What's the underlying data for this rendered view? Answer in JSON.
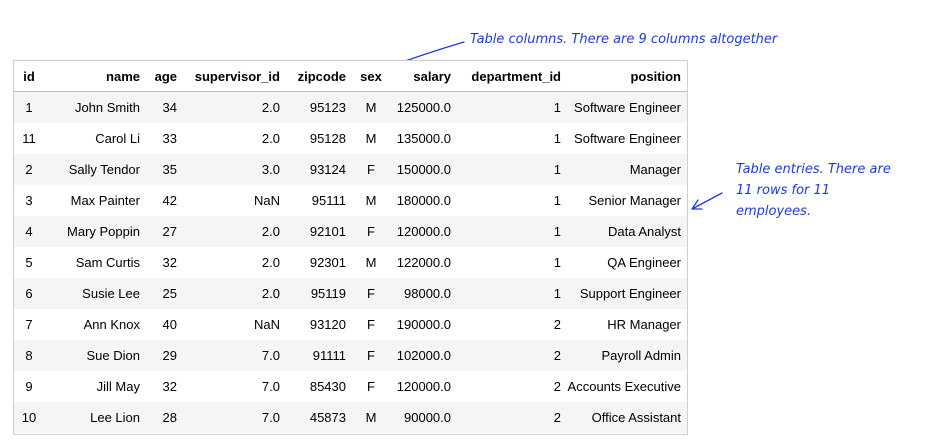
{
  "annotations": {
    "columns_note": "Table columns. There are 9 columns altogether",
    "rows_note": "Table entries. There are 11 rows for 11 employees.",
    "rows_note_lines": [
      "Table entries. There are",
      "11 rows for 11",
      "employees."
    ],
    "color": "#1f3bd6"
  },
  "table": {
    "columns": [
      "id",
      "name",
      "age",
      "supervisor_id",
      "zipcode",
      "sex",
      "salary",
      "department_id",
      "position"
    ],
    "rows": [
      [
        "1",
        "John Smith",
        "34",
        "2.0",
        "95123",
        "M",
        "125000.0",
        "1",
        "Software Engineer"
      ],
      [
        "11",
        "Carol Li",
        "33",
        "2.0",
        "95128",
        "M",
        "135000.0",
        "1",
        "Software Engineer"
      ],
      [
        "2",
        "Sally Tendor",
        "35",
        "3.0",
        "93124",
        "F",
        "150000.0",
        "1",
        "Manager"
      ],
      [
        "3",
        "Max Painter",
        "42",
        "NaN",
        "95111",
        "M",
        "180000.0",
        "1",
        "Senior Manager"
      ],
      [
        "4",
        "Mary Poppin",
        "27",
        "2.0",
        "92101",
        "F",
        "120000.0",
        "1",
        "Data Analyst"
      ],
      [
        "5",
        "Sam Curtis",
        "32",
        "2.0",
        "92301",
        "M",
        "122000.0",
        "1",
        "QA Engineer"
      ],
      [
        "6",
        "Susie Lee",
        "25",
        "2.0",
        "95119",
        "F",
        "98000.0",
        "1",
        "Support Engineer"
      ],
      [
        "7",
        "Ann Knox",
        "40",
        "NaN",
        "93120",
        "F",
        "190000.0",
        "2",
        "HR Manager"
      ],
      [
        "8",
        "Sue Dion",
        "29",
        "7.0",
        "91111",
        "F",
        "102000.0",
        "2",
        "Payroll Admin"
      ],
      [
        "9",
        "Jill May",
        "32",
        "7.0",
        "85430",
        "F",
        "120000.0",
        "2",
        "Accounts Executive"
      ],
      [
        "10",
        "Lee Lion",
        "28",
        "7.0",
        "45873",
        "M",
        "90000.0",
        "2",
        "Office Assistant"
      ]
    ]
  }
}
